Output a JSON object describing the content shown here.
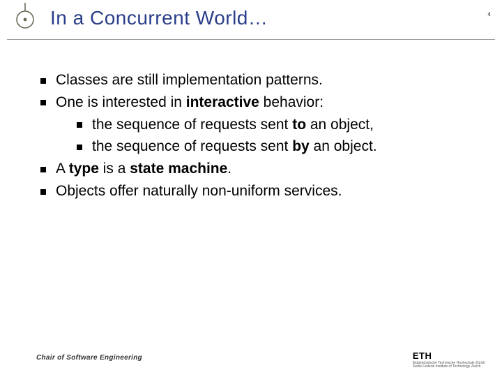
{
  "header": {
    "title": "In a Concurrent World…",
    "page_number": "4"
  },
  "bullets": {
    "b1": "Classes are still implementation patterns.",
    "b2_pre": "One is interested in ",
    "b2_bold": "interactive",
    "b2_post": " behavior:",
    "b2_s1_pre": "the sequence of requests sent ",
    "b2_s1_bold": "to",
    "b2_s1_post": " an object,",
    "b2_s2_pre": "the sequence of requests sent ",
    "b2_s2_bold": "by",
    "b2_s2_post": " an object.",
    "b3_pre": "A ",
    "b3_bold1": "type",
    "b3_mid": " is a ",
    "b3_bold2": "state machine",
    "b3_post": ".",
    "b4": "Objects offer naturally non-uniform services."
  },
  "footer": {
    "chair": "Chair of Software Engineering",
    "eth": "ETH",
    "eth_sub1": "Eidgenössische Technische Hochschule Zürich",
    "eth_sub2": "Swiss Federal Institute of Technology Zurich"
  }
}
